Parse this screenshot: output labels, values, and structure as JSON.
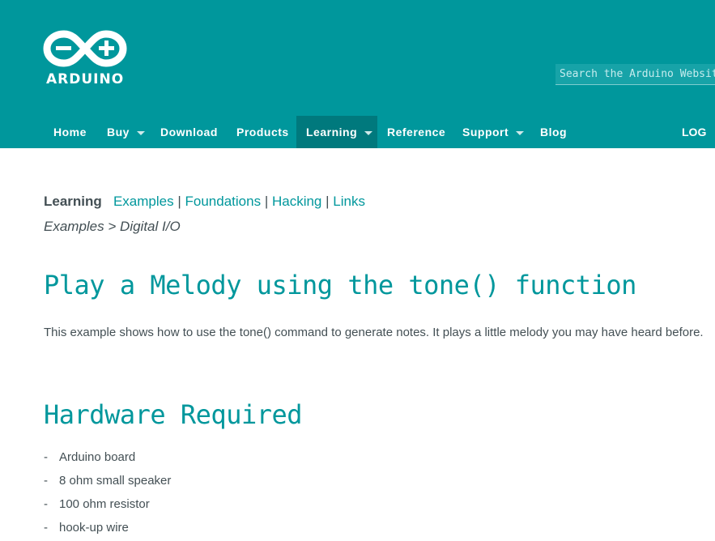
{
  "header": {
    "logo_text": "ARDUINO",
    "search_placeholder": "Search the Arduino Website",
    "nav": [
      {
        "label": "Home",
        "dropdown": false
      },
      {
        "label": "Buy",
        "dropdown": true
      },
      {
        "label": "Download",
        "dropdown": false
      },
      {
        "label": "Products",
        "dropdown": false
      },
      {
        "label": "Learning",
        "dropdown": true,
        "active": true
      },
      {
        "label": "Reference",
        "dropdown": false
      },
      {
        "label": "Support",
        "dropdown": true
      },
      {
        "label": "Blog",
        "dropdown": false
      }
    ],
    "login_label": "LOG IN",
    "colors": {
      "brand": "#00979c",
      "active": "#00797d"
    }
  },
  "subnav": {
    "current": "Learning",
    "links": [
      "Examples",
      "Foundations",
      "Hacking",
      "Links"
    ],
    "separator": "|"
  },
  "breadcrumb": {
    "parent": "Examples",
    "separator": ">",
    "current": "Digital I/O"
  },
  "article": {
    "title": "Play a Melody using the tone() function",
    "intro": "This example shows how to use the tone() command to generate notes. It plays a little melody you may have heard before.",
    "hardware_heading": "Hardware Required",
    "hardware_items": [
      "Arduino board",
      "8 ohm small speaker",
      "100 ohm resistor",
      "hook-up wire"
    ],
    "list_marker": "-"
  }
}
